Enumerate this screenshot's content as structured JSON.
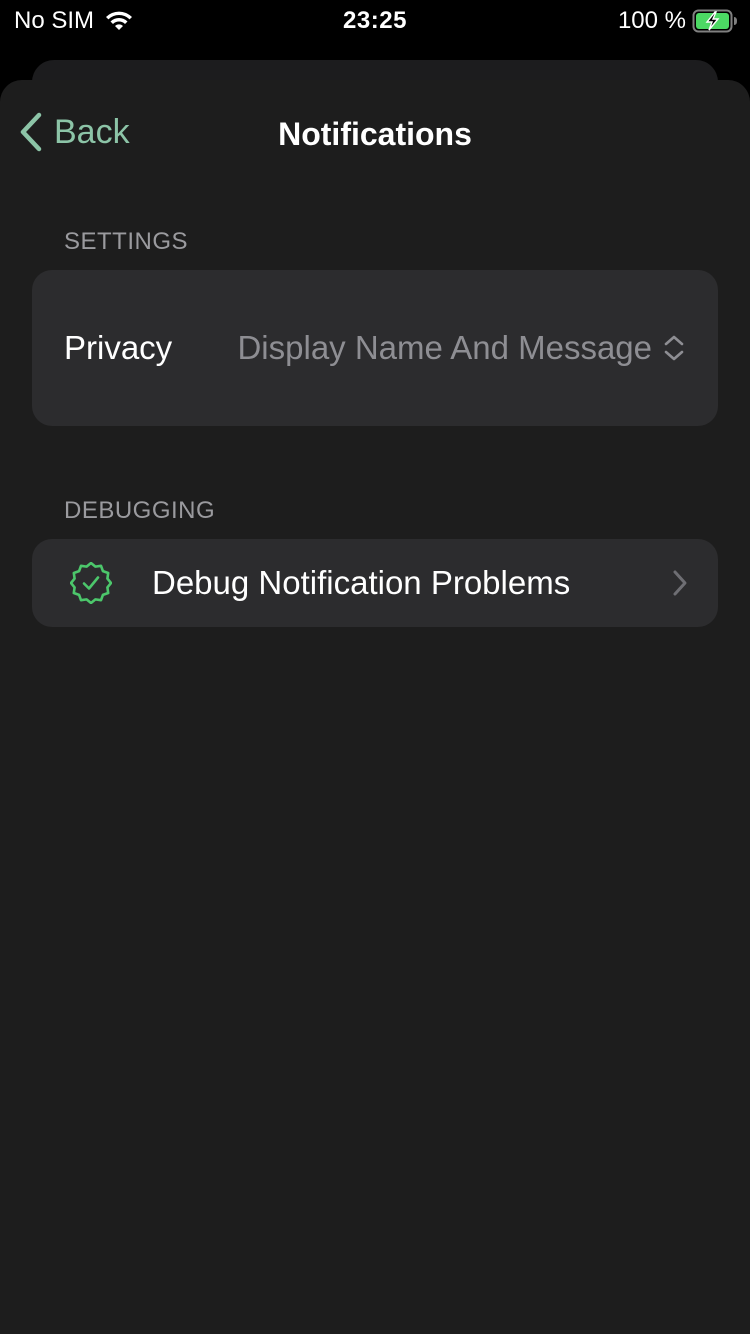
{
  "status_bar": {
    "carrier": "No SIM",
    "time": "23:25",
    "battery_percent": "100 %",
    "icons": [
      "wifi-icon",
      "battery-charging-icon"
    ]
  },
  "nav": {
    "back_label": "Back",
    "title": "Notifications"
  },
  "sections": {
    "settings": {
      "header": "SETTINGS",
      "privacy_label": "Privacy",
      "privacy_value": "Display Name And Message"
    },
    "debugging": {
      "header": "DEBUGGING",
      "debug_label": "Debug Notification Problems"
    }
  },
  "colors": {
    "accent": "#8cc4a7",
    "icon_green": "#4cc76b",
    "background": "#1d1d1d",
    "cell": "#2c2c2e",
    "secondary_text": "#8e8e93"
  }
}
